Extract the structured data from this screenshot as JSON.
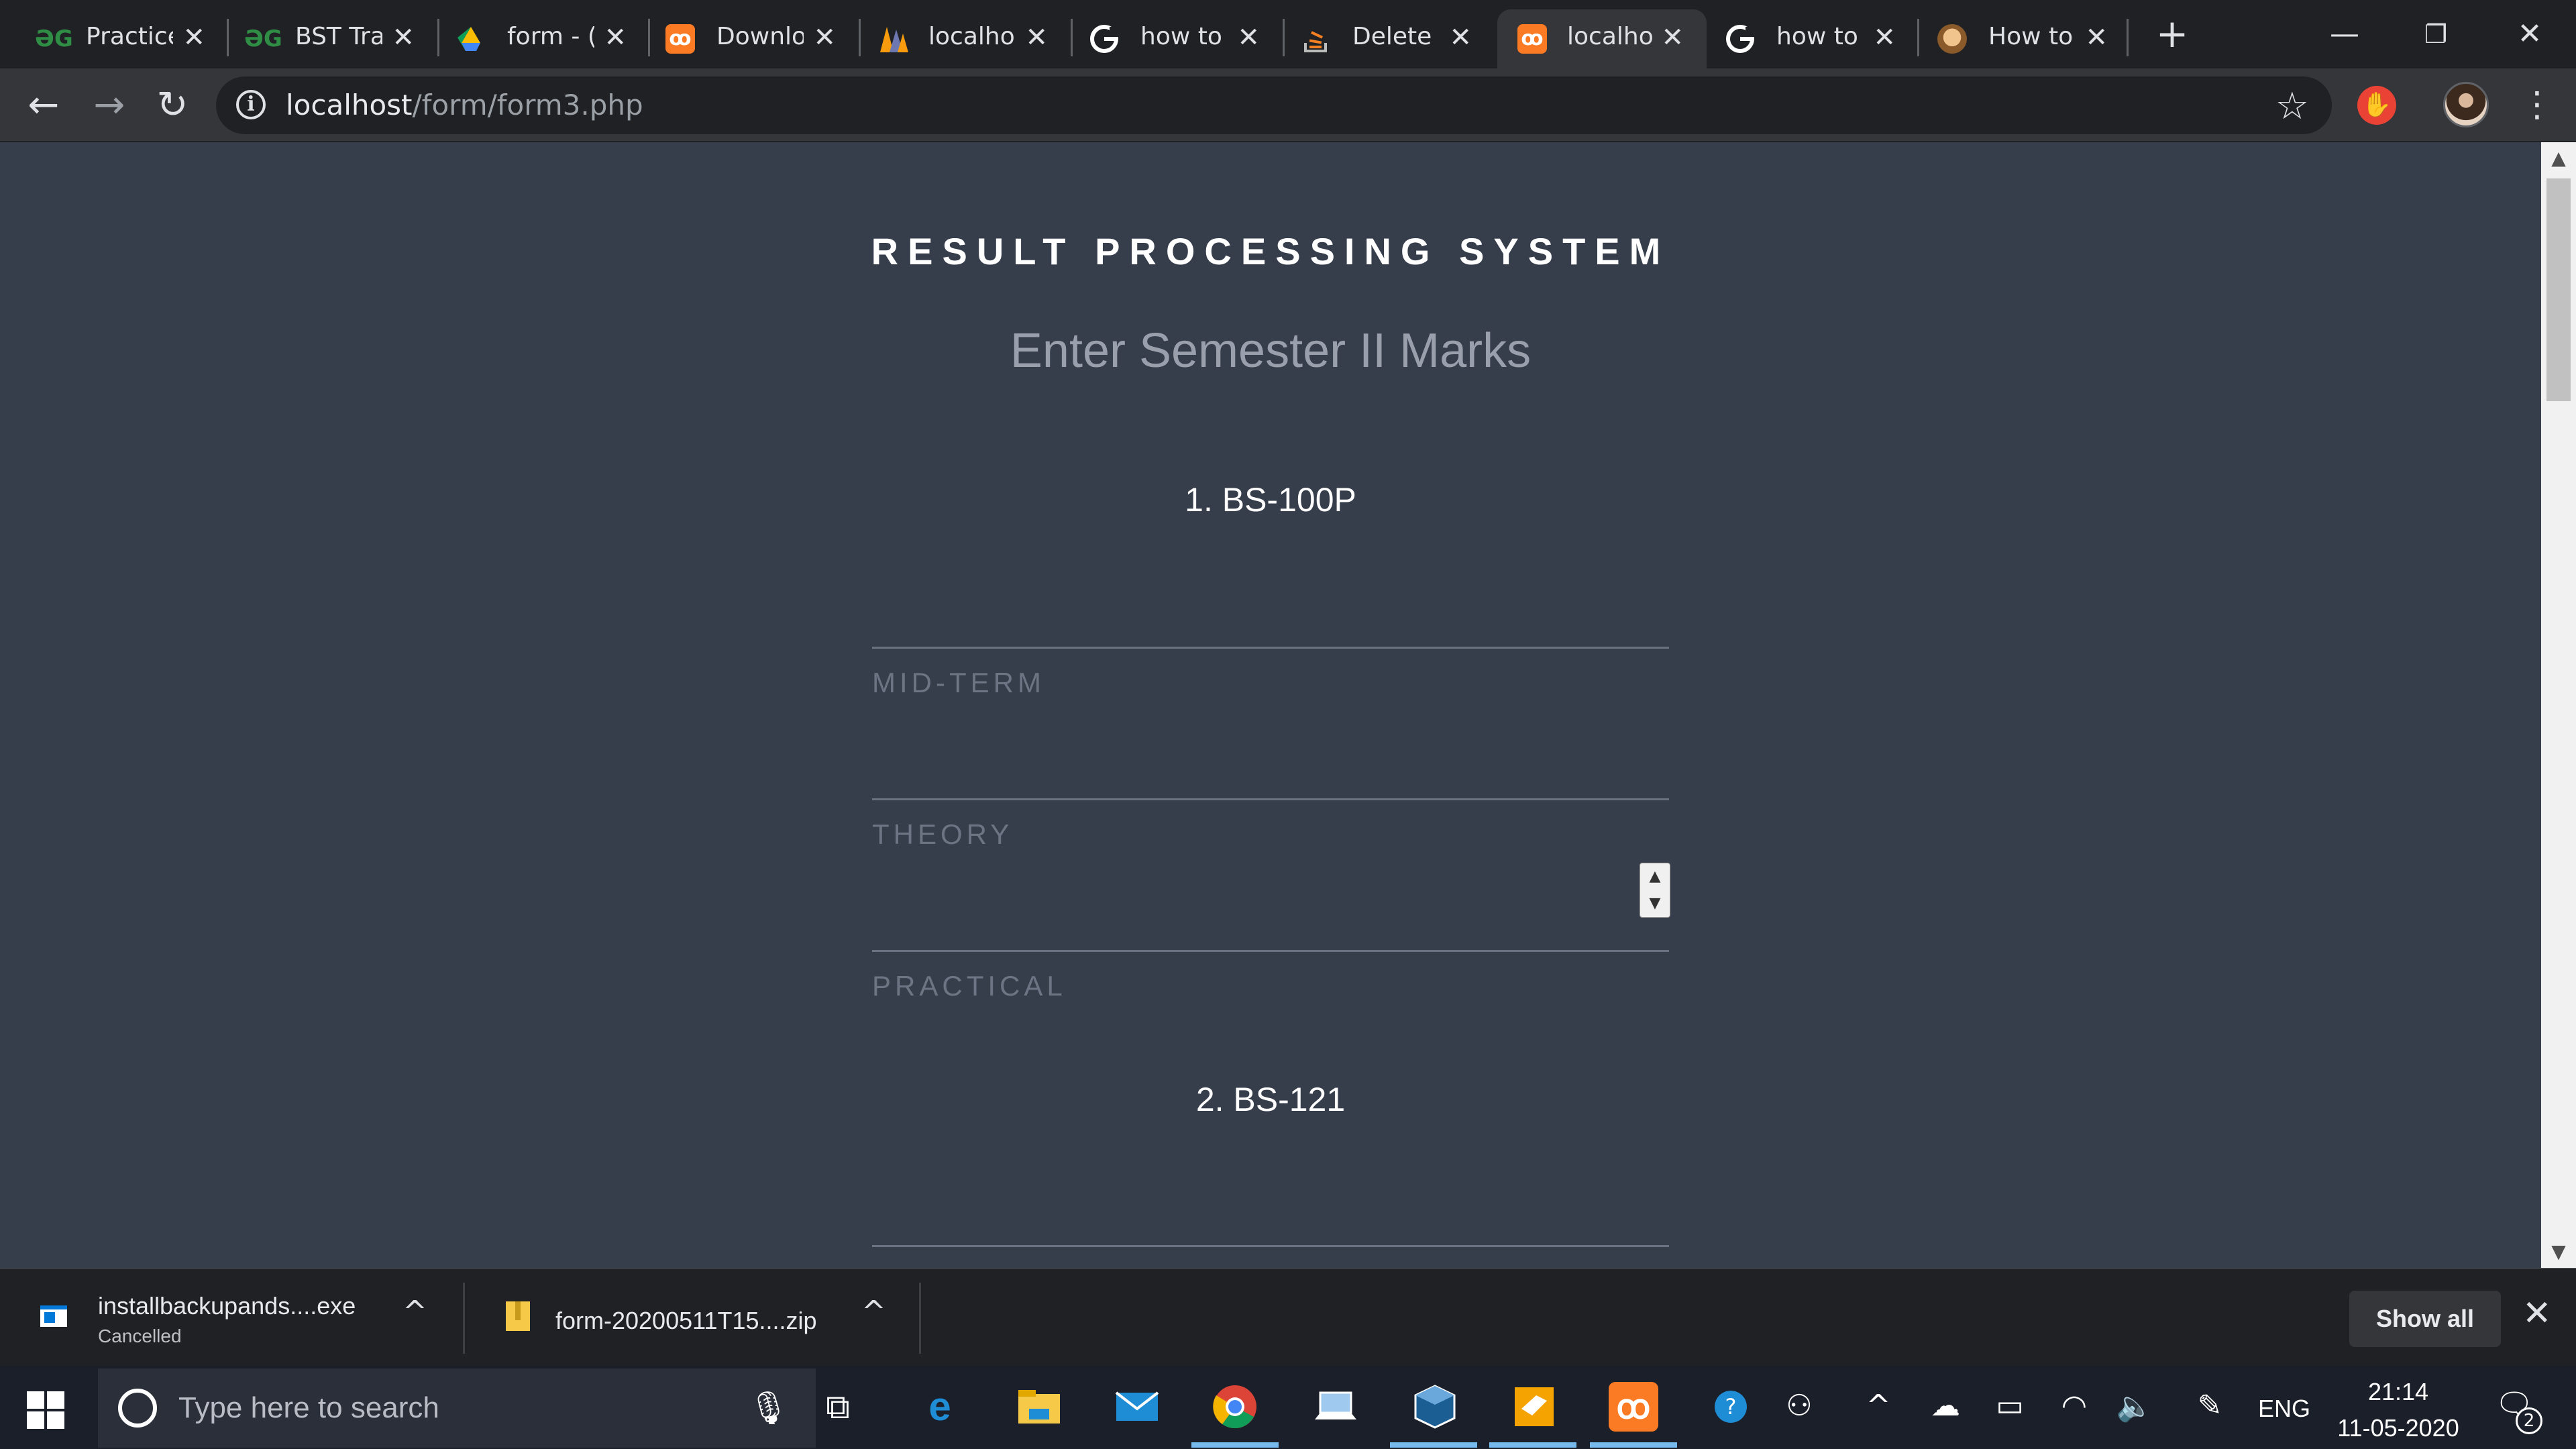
{
  "browser": {
    "tabs": [
      {
        "title": "Practice",
        "icon": "geeksforgeeks-icon"
      },
      {
        "title": "BST Tra",
        "icon": "geeksforgeeks-icon"
      },
      {
        "title": "form - (",
        "icon": "google-drive-icon"
      },
      {
        "title": "Downlo",
        "icon": "xampp-icon"
      },
      {
        "title": "localhos",
        "icon": "phpmyadmin-icon"
      },
      {
        "title": "how to",
        "icon": "google-icon"
      },
      {
        "title": "Delete a",
        "icon": "stackoverflow-icon"
      },
      {
        "title": "localhos",
        "icon": "xampp-icon",
        "active": true
      },
      {
        "title": "how to",
        "icon": "google-icon"
      },
      {
        "title": "How to",
        "icon": "avatar-icon"
      }
    ],
    "address": {
      "host": "localhost",
      "path": "/form/form3.php"
    }
  },
  "page": {
    "title": "RESULT PROCESSING SYSTEM",
    "subtitle": "Enter Semester II Marks",
    "subjects": [
      {
        "label": "1. BS-100P",
        "fields": {
          "mid_term": "MID-TERM",
          "theory": "THEORY",
          "practical": "PRACTICAL"
        }
      },
      {
        "label": "2. BS-121"
      }
    ]
  },
  "downloads": {
    "items": [
      {
        "name": "installbackupands....exe",
        "status": "Cancelled"
      },
      {
        "name": "form-20200511T15....zip",
        "status": ""
      }
    ],
    "show_all": "Show all"
  },
  "taskbar": {
    "search_placeholder": "Type here to search",
    "language": "ENG",
    "time": "21:14",
    "date": "11-05-2020",
    "notification_count": "2"
  },
  "colors": {
    "page_background": "#363d4b",
    "chrome_dark": "#202124",
    "chrome_toolbar": "#35363a",
    "taskbar": "#1b1f29",
    "accent_active": "#76b9ed"
  }
}
